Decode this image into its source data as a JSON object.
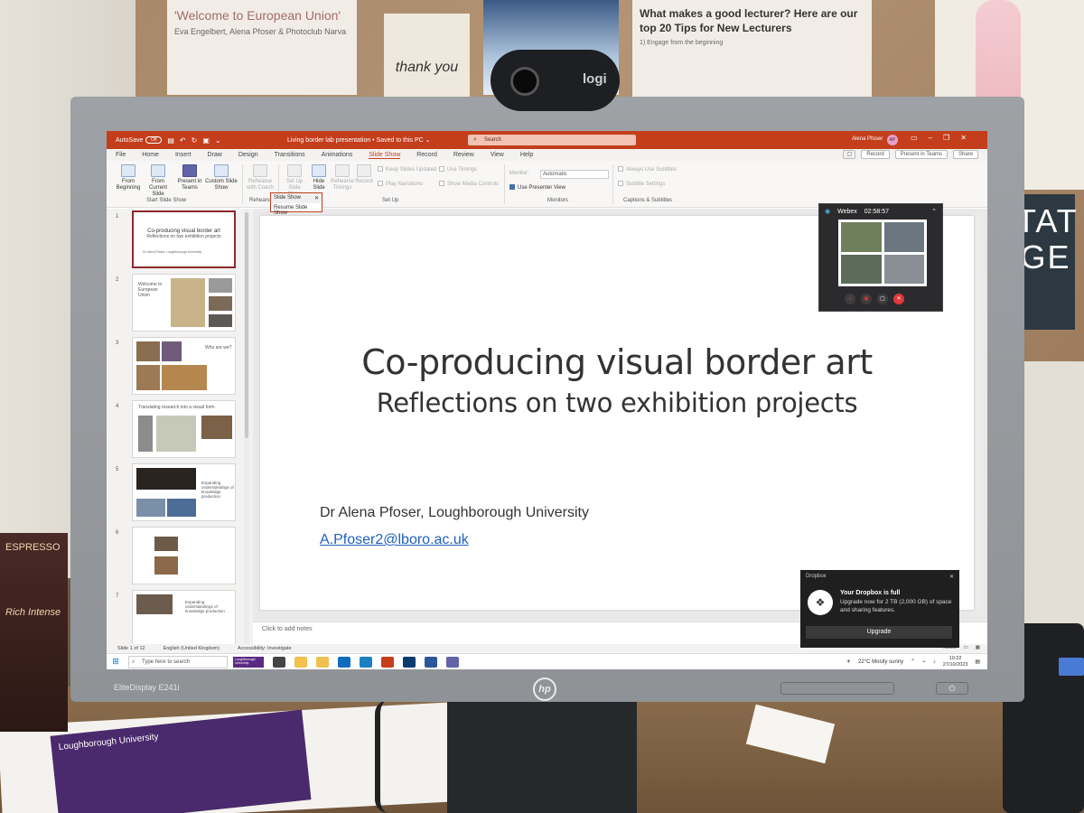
{
  "environment": {
    "poster_welcome": "'Welcome to European Union'",
    "poster_welcome_sub": "Eva Engelbert, Alena Pfoser & Photoclub Narva",
    "poster_thankyou": "thank you",
    "poster_tips_title": "What makes a good lecturer? Here are our top 20 Tips for New Lecturers",
    "poster_tips_body": "1) Engage from the beginning",
    "sign_letters": "TAT GE",
    "coffee_text": "ESPRESSO",
    "coffee_tagline": "Rich Intense",
    "leaflet_text": "Loughborough University",
    "webcam_brand": "logi",
    "monitor_model": "EliteDisplay E241i",
    "monitor_brand": "hp"
  },
  "colors": {
    "accent": "#c43e1c",
    "link": "#1f5fbf",
    "selected_thumb_border": "#8b2a2a"
  },
  "app": {
    "titlebar": {
      "autosave_label": "AutoSave",
      "autosave_state": "Off",
      "doc_title": "Living border lab presentation • Saved to this PC ⌄",
      "search_placeholder": "Search",
      "user_name": "Alena Pfoser",
      "user_initials": "AP"
    },
    "menu": {
      "tabs": [
        "File",
        "Home",
        "Insert",
        "Draw",
        "Design",
        "Transitions",
        "Animations",
        "Slide Show",
        "Record",
        "Review",
        "View",
        "Help"
      ],
      "active_tab": "Slide Show",
      "record_button": "Record",
      "present_teams_button": "Present in Teams",
      "share_button": "Share"
    },
    "ribbon": {
      "from_beginning": "From Beginning",
      "from_current": "From Current Slide",
      "present_teams": "Present in Teams",
      "custom_slide_show": "Custom Slide Show",
      "start_group": "Start Slide Show",
      "rehearse": "Rehearse with Coach",
      "rehearse_group": "Rehearse",
      "set_up": "Set Up Slide Show",
      "hide_slide": "Hide Slide",
      "rehearse_timings": "Rehearse Timings",
      "record": "Record",
      "keep_updated": "Keep Slides Updated",
      "play_narrations": "Play Narrations",
      "use_timings": "Use Timings",
      "show_media_controls": "Show Media Controls",
      "setup_group": "Set Up",
      "monitor_label": "Monitor:",
      "monitor_value": "Automatic",
      "use_presenter_view": "Use Presenter View",
      "monitors_group": "Monitors",
      "always_subtitles": "Always Use Subtitles",
      "subtitle_settings": "Subtitle Settings",
      "captions_group": "Captions & Subtitles"
    },
    "dropdown": {
      "head": "Slide Show",
      "item": "Resume Slide Show"
    },
    "thumbnails": [
      {
        "num": "1",
        "title": "Co-producing visual border art",
        "sub": "Reflections on two exhibition projects",
        "small": "Dr Alena Pfoser, Loughborough University"
      },
      {
        "num": "2",
        "title": "Welcome to European Union",
        "sub": "",
        "small": ""
      },
      {
        "num": "3",
        "title": "Who are we?",
        "sub": "",
        "small": ""
      },
      {
        "num": "4",
        "title": "Translating research into a visual form",
        "sub": "",
        "small": ""
      },
      {
        "num": "5",
        "title": "Expanding understandings of knowledge production",
        "sub": "",
        "small": ""
      },
      {
        "num": "6",
        "title": "",
        "sub": "",
        "small": ""
      },
      {
        "num": "7",
        "title": "Expanding understandings of knowledge production",
        "sub": "",
        "small": ""
      }
    ],
    "slide": {
      "title": "Co-producing visual border art",
      "subtitle": "Reflections on two exhibition projects",
      "author": "Dr Alena Pfoser, Loughborough University",
      "email": "A.Pfoser2@lboro.ac.uk"
    },
    "notes_placeholder": "Click to add notes",
    "status": {
      "slide_count": "Slide 1 of 12",
      "language": "English (United Kingdom)",
      "accessibility": "Accessibility: Investigate",
      "notes": "Notes"
    }
  },
  "taskbar": {
    "search_placeholder": "Type here to search",
    "badge": "Loughborough University",
    "weather": "22°C  Mostly sunny",
    "time": "10:22",
    "date": "27/10/2023"
  },
  "webex": {
    "app_name": "Webex",
    "timer": "02:58:57"
  },
  "dropbox": {
    "app_name": "Dropbox",
    "title": "Your Dropbox is full",
    "body": "Upgrade now for 2 TB (2,000 GB) of space and sharing features.",
    "button": "Upgrade"
  }
}
